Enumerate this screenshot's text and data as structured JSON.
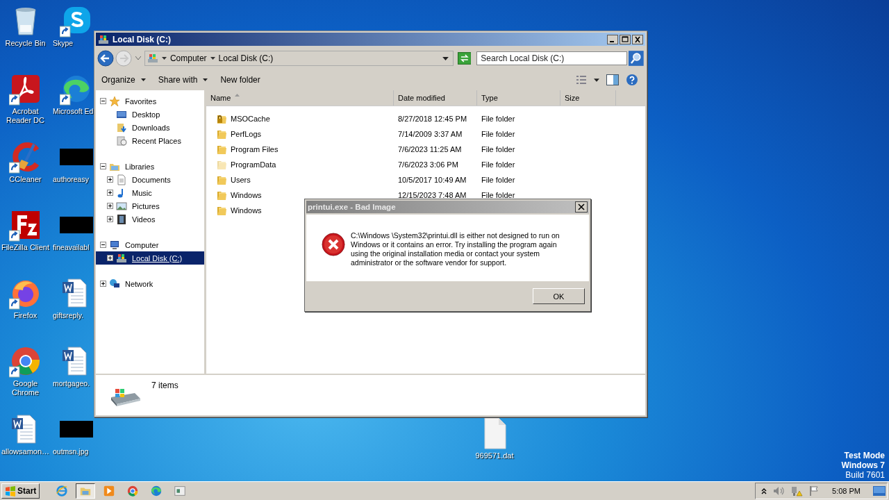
{
  "desktop": {
    "icons": [
      {
        "label": "Recycle Bin",
        "kind": "recycle",
        "shortcut": false
      },
      {
        "label": "Acrobat Reader DC",
        "kind": "acrobat",
        "shortcut": true
      },
      {
        "label": "CCleaner",
        "kind": "ccleaner",
        "shortcut": true
      },
      {
        "label": "FileZilla Client",
        "kind": "filezilla",
        "shortcut": true
      },
      {
        "label": "Firefox",
        "kind": "firefox",
        "shortcut": true
      },
      {
        "label": "Google Chrome",
        "kind": "chrome",
        "shortcut": true
      },
      {
        "label": "allowsamon…",
        "kind": "word",
        "shortcut": false
      },
      {
        "label": "Skype",
        "kind": "skype",
        "shortcut": true
      },
      {
        "label": "Microsoft Ed",
        "kind": "edge",
        "shortcut": true
      },
      {
        "label": "authoreasy",
        "kind": "blacked",
        "shortcut": false
      },
      {
        "label": "fineavailabl",
        "kind": "blacked",
        "shortcut": false
      },
      {
        "label": "giftsreply.",
        "kind": "word",
        "shortcut": false
      },
      {
        "label": "mortgageo.",
        "kind": "word",
        "shortcut": false
      },
      {
        "label": "outmsn.jpg",
        "kind": "blacked",
        "shortcut": false
      }
    ],
    "files": [
      {
        "label": "969571.dat",
        "kind": "file"
      }
    ],
    "system_notice": [
      "Test Mode",
      "Windows 7",
      "Build 7601"
    ]
  },
  "explorer": {
    "title": "Local Disk (C:)",
    "breadcrumb": [
      "Computer",
      "Local Disk (C:)"
    ],
    "search": {
      "placeholder": "Search Local Disk (C:)"
    },
    "toolbar": [
      {
        "label": "Organize",
        "dropdown": true
      },
      {
        "label": "Share with",
        "dropdown": true
      },
      {
        "label": "New folder",
        "dropdown": false
      }
    ],
    "nav": [
      {
        "label": "Favorites",
        "kind": "star",
        "expanded": true,
        "selected": false,
        "children": [
          {
            "label": "Desktop",
            "kind": "desktop",
            "selected": false
          },
          {
            "label": "Downloads",
            "kind": "downloads",
            "selected": false
          },
          {
            "label": "Recent Places",
            "kind": "recent",
            "selected": false
          }
        ]
      },
      {
        "label": "Libraries",
        "kind": "libraries",
        "expanded": true,
        "selected": false,
        "children": [
          {
            "label": "Documents",
            "kind": "documents",
            "expanded": false,
            "selected": false
          },
          {
            "label": "Music",
            "kind": "music",
            "expanded": false,
            "selected": false
          },
          {
            "label": "Pictures",
            "kind": "pictures",
            "expanded": false,
            "selected": false
          },
          {
            "label": "Videos",
            "kind": "videos",
            "expanded": false,
            "selected": false
          }
        ]
      },
      {
        "label": "Computer",
        "kind": "computer",
        "expanded": true,
        "selected": false,
        "children": [
          {
            "label": "Local Disk (C:)",
            "kind": "disk",
            "expanded": false,
            "selected": true
          }
        ]
      },
      {
        "label": "Network",
        "kind": "network",
        "expanded": false,
        "selected": false
      }
    ],
    "columns": [
      {
        "label": "Name",
        "sorted": true
      },
      {
        "label": "Date modified",
        "sorted": false
      },
      {
        "label": "Type",
        "sorted": false
      },
      {
        "label": "Size",
        "sorted": false
      }
    ],
    "rows": [
      {
        "name": "MSOCache",
        "date": "8/27/2018 12:45 PM",
        "type": "File folder",
        "kind": "locked-folder",
        "hidden": false
      },
      {
        "name": "PerfLogs",
        "date": "7/14/2009 3:37 AM",
        "type": "File folder",
        "kind": "folder",
        "hidden": false
      },
      {
        "name": "Program Files",
        "date": "7/6/2023 11:25 AM",
        "type": "File folder",
        "kind": "folder",
        "hidden": false
      },
      {
        "name": "ProgramData",
        "date": "7/6/2023 3:06 PM",
        "type": "File folder",
        "kind": "folder",
        "hidden": true
      },
      {
        "name": "Users",
        "date": "10/5/2017 10:49 AM",
        "type": "File folder",
        "kind": "folder",
        "hidden": false
      },
      {
        "name": "Windows",
        "date": "12/15/2023 7:48 AM",
        "type": "File folder",
        "kind": "folder",
        "hidden": false
      },
      {
        "name": "Windows",
        "kind": "folder",
        "hidden": false
      }
    ],
    "status": "7 items"
  },
  "dialog": {
    "title": "printui.exe - Bad Image",
    "active": false,
    "message": "C:\\Windows \\System32\\printui.dll is either not designed to run on Windows or it contains an error. Try installing the program again using the original installation media or contact your system administrator or the software vendor for support.",
    "button": "OK"
  },
  "taskbar": {
    "start": "Start",
    "apps": [
      {
        "kind": "ie",
        "selected": false
      },
      {
        "kind": "explorer",
        "selected": true
      },
      {
        "kind": "media",
        "selected": false
      },
      {
        "kind": "chrome",
        "selected": false
      },
      {
        "kind": "edge",
        "selected": false
      },
      {
        "kind": "window",
        "selected": false
      }
    ],
    "clock": "5:08 PM"
  }
}
